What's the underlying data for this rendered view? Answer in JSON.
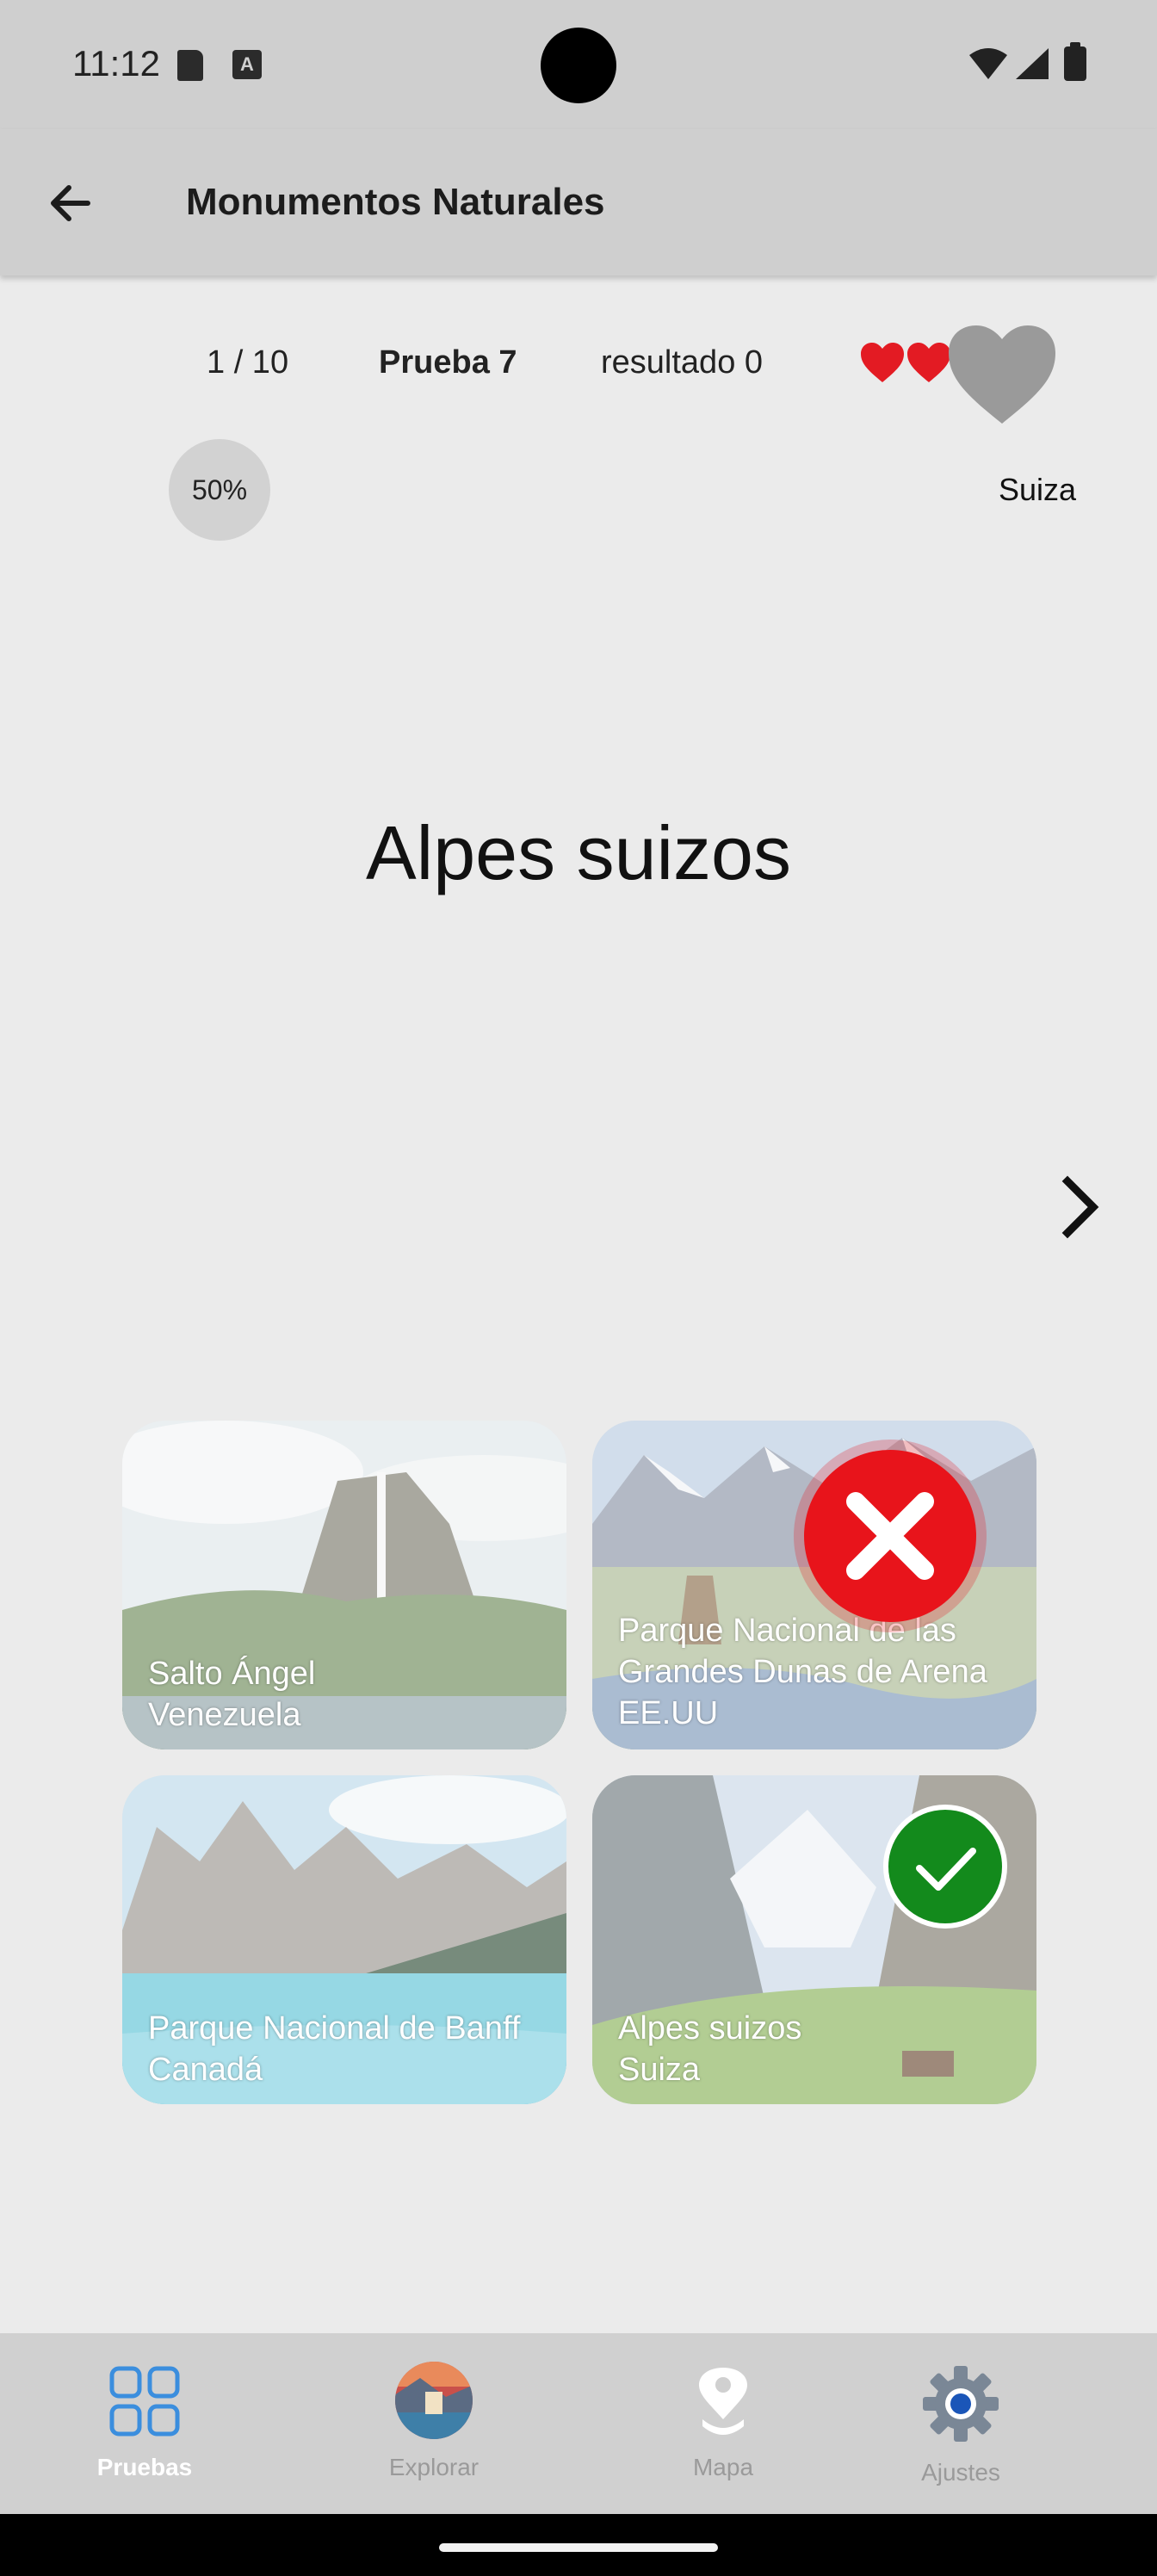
{
  "status_bar": {
    "time": "11:12",
    "a_icon_letter": "A"
  },
  "app_bar": {
    "title": "Monumentos Naturales"
  },
  "quiz": {
    "progress": "1 / 10",
    "name": "Prueba 7",
    "score": "resultado 0",
    "hearts_remaining": 2,
    "hearts_total": 3,
    "percent": "50%",
    "country": "Suiza"
  },
  "question": {
    "title": "Alpes suizos"
  },
  "options": [
    {
      "line1": "Salto Ángel",
      "line2": "Venezuela",
      "line3": ""
    },
    {
      "line1": "Parque Nacional de las",
      "line2": "Grandes Dunas de Arena",
      "line3": "EE.UU"
    },
    {
      "line1": "Parque Nacional de Banff",
      "line2": "Canadá",
      "line3": ""
    },
    {
      "line1": "Alpes suizos",
      "line2": "Suiza",
      "line3": ""
    }
  ],
  "feedback": {
    "wrong_option": 2,
    "correct_option": 4
  },
  "bottom_nav": {
    "items": [
      {
        "label": "Pruebas",
        "icon": "grid-icon",
        "active": true
      },
      {
        "label": "Explorar",
        "icon": "explore-photo-icon",
        "active": false
      },
      {
        "label": "Mapa",
        "icon": "map-pin-icon",
        "active": false
      },
      {
        "label": "Ajustes",
        "icon": "gear-icon",
        "active": false
      }
    ]
  },
  "colors": {
    "accent_blue": "#3b8ede",
    "wrong_red": "#e8141b",
    "correct_green": "#138a1c",
    "heart_red": "#e31b23",
    "heart_grey": "#9a9a9a"
  }
}
